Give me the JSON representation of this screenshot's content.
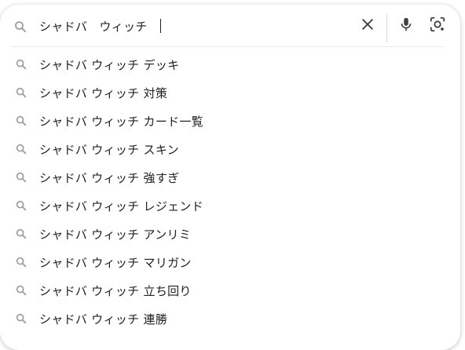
{
  "search": {
    "query": "シャドバ　ウィッチ",
    "icons": {
      "leading": "search-icon",
      "clear": "close-icon",
      "voice": "microphone-icon",
      "image": "lens-camera-icon"
    }
  },
  "colors": {
    "text": "#202124",
    "icon_gray": "#9aa0a6",
    "icon_dark": "#3c4043"
  },
  "suggestions": [
    {
      "label": "シャドバ ウィッチ デッキ"
    },
    {
      "label": "シャドバ ウィッチ 対策"
    },
    {
      "label": "シャドバ ウィッチ カード一覧"
    },
    {
      "label": "シャドバ ウィッチ スキン"
    },
    {
      "label": "シャドバ ウィッチ 強すぎ"
    },
    {
      "label": "シャドバ ウィッチ レジェンド"
    },
    {
      "label": "シャドバ ウィッチ アンリミ"
    },
    {
      "label": "シャドバ ウィッチ マリガン"
    },
    {
      "label": "シャドバ ウィッチ 立ち回り"
    },
    {
      "label": "シャドバ ウィッチ 連勝"
    }
  ]
}
